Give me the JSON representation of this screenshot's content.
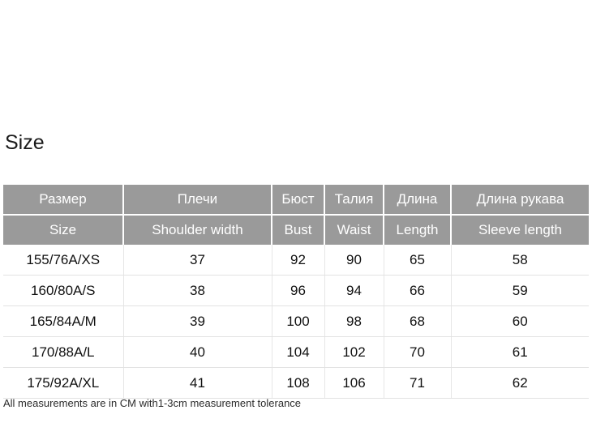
{
  "title": "Size",
  "footnote": "All measurements are in CM with1-3cm measurement tolerance",
  "colors": {
    "header_background": "#9a9a9a",
    "header_text": "#ffffff",
    "body_background": "#ffffff",
    "body_text": "#111111",
    "row_divider": "#e2e2e2"
  },
  "table": {
    "headers_ru": [
      "Размер",
      "Плечи",
      "Бюст",
      "Талия",
      "Длина",
      "Длина рукава"
    ],
    "headers_en": [
      "Size",
      "Shoulder width",
      "Bust",
      "Waist",
      "Length",
      "Sleeve length"
    ],
    "rows": [
      {
        "size": "155/76A/XS",
        "shoulder_width": "37",
        "bust": "92",
        "waist": "90",
        "length": "65",
        "sleeve_length": "58"
      },
      {
        "size": "160/80A/S",
        "shoulder_width": "38",
        "bust": "96",
        "waist": "94",
        "length": "66",
        "sleeve_length": "59"
      },
      {
        "size": "165/84A/M",
        "shoulder_width": "39",
        "bust": "100",
        "waist": "98",
        "length": "68",
        "sleeve_length": "60"
      },
      {
        "size": "170/88A/L",
        "shoulder_width": "40",
        "bust": "104",
        "waist": "102",
        "length": "70",
        "sleeve_length": "61"
      },
      {
        "size": "175/92A/XL",
        "shoulder_width": "41",
        "bust": "108",
        "waist": "106",
        "length": "71",
        "sleeve_length": "62"
      }
    ]
  }
}
